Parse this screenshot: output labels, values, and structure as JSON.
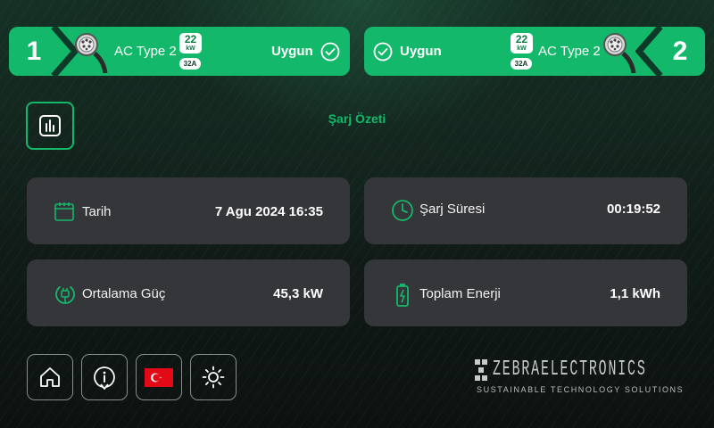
{
  "connectors": [
    {
      "number": "1",
      "type": "AC Type 2",
      "power_value": "22",
      "power_unit": "kW",
      "current": "32A",
      "status": "Uygun"
    },
    {
      "number": "2",
      "type": "AC Type 2",
      "power_value": "22",
      "power_unit": "kW",
      "current": "32A",
      "status": "Uygun"
    }
  ],
  "page_title": "Şarj Özeti",
  "cards": {
    "date": {
      "label": "Tarih",
      "value": "7 Agu 2024 16:35",
      "icon": "calendar-icon"
    },
    "duration": {
      "label": "Şarj Süresi",
      "value": "00:19:52",
      "icon": "clock-icon"
    },
    "power": {
      "label": "Ortalama Güç",
      "value": "45,3 kW",
      "icon": "power-plug-icon"
    },
    "energy": {
      "label": "Toplam Enerji",
      "value": "1,1 kWh",
      "icon": "battery-icon"
    }
  },
  "bottom_buttons": [
    {
      "name": "home",
      "icon": "home-icon"
    },
    {
      "name": "info",
      "icon": "info-icon"
    },
    {
      "name": "language",
      "icon": "turkey-flag-icon"
    },
    {
      "name": "brightness",
      "icon": "brightness-icon"
    }
  ],
  "logo": {
    "brand": "ZEBRAELECTRONICS",
    "tagline": "SUSTAINABLE TECHNOLOGY SOLUTIONS"
  },
  "colors": {
    "accent": "#14b86a",
    "card": "#353639",
    "flag": "#e30a17"
  }
}
